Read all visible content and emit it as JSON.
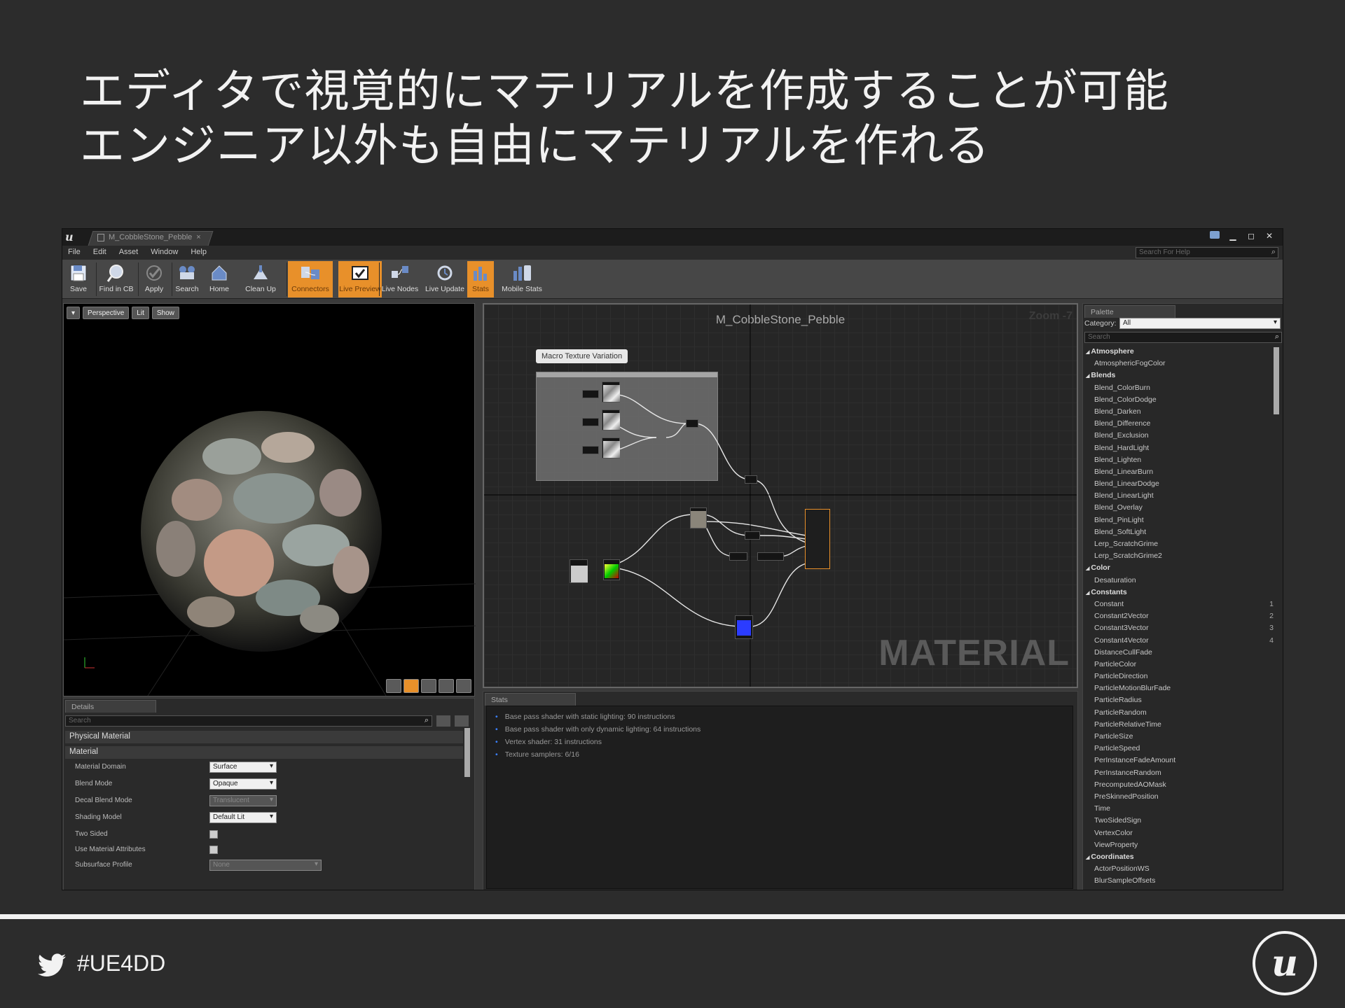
{
  "slide": {
    "title_line1": "エディタで視覚的にマテリアルを作成することが可能",
    "title_line2": "エンジニア以外も自由にマテリアルを作れる",
    "hashtag": "#UE4DD"
  },
  "window": {
    "tab_title": "M_CobbleStone_Pebble",
    "tab_close": "×"
  },
  "menu": [
    "File",
    "Edit",
    "Asset",
    "Window",
    "Help"
  ],
  "help_search": {
    "placeholder": "Search For Help"
  },
  "toolbar": [
    {
      "label": "Save",
      "icon": "save-icon",
      "active": false
    },
    {
      "label": "Find in CB",
      "icon": "find-in-content-browser-icon",
      "active": false
    },
    {
      "label": "Apply",
      "icon": "apply-icon",
      "active": false
    },
    {
      "label": "Search",
      "icon": "search-icon",
      "active": false
    },
    {
      "label": "Home",
      "icon": "home-icon",
      "active": false
    },
    {
      "label": "Clean Up",
      "icon": "clean-up-icon",
      "active": false
    },
    {
      "label": "Connectors",
      "icon": "connectors-icon",
      "active": true
    },
    {
      "label": "Live Preview",
      "icon": "live-preview-icon",
      "active": true
    },
    {
      "label": "Live Nodes",
      "icon": "live-nodes-icon",
      "active": false
    },
    {
      "label": "Live Update",
      "icon": "live-update-icon",
      "active": false
    },
    {
      "label": "Stats",
      "icon": "stats-icon",
      "active": true
    },
    {
      "label": "Mobile Stats",
      "icon": "mobile-stats-icon",
      "active": false
    }
  ],
  "viewport": {
    "perspective": "Perspective",
    "lit": "Lit",
    "show": "Show"
  },
  "details": {
    "tab": "Details",
    "search_placeholder": "Search",
    "cat_physical": "Physical Material",
    "cat_material": "Material",
    "props": [
      {
        "label": "Material Domain",
        "value": "Surface",
        "type": "dropdown"
      },
      {
        "label": "Blend Mode",
        "value": "Opaque",
        "type": "dropdown"
      },
      {
        "label": "Decal Blend Mode",
        "value": "Translucent",
        "type": "dropdown-disabled"
      },
      {
        "label": "Shading Model",
        "value": "Default Lit",
        "type": "dropdown"
      },
      {
        "label": "Two Sided",
        "value": "",
        "type": "checkbox"
      },
      {
        "label": "Use Material Attributes",
        "value": "",
        "type": "checkbox"
      },
      {
        "label": "Subsurface Profile",
        "value": "None",
        "type": "asset"
      }
    ]
  },
  "graph": {
    "title": "M_CobbleStone_Pebble",
    "zoom": "Zoom -7",
    "comment": "Macro Texture Variation",
    "watermark": "MATERIAL"
  },
  "stats": {
    "tab": "Stats",
    "lines": [
      "Base pass shader with static lighting: 90 instructions",
      "Base pass shader with only dynamic lighting: 64 instructions",
      "Vertex shader: 31 instructions",
      "Texture samplers: 6/16"
    ]
  },
  "palette": {
    "tab": "Palette",
    "category_label": "Category:",
    "category_value": "All",
    "search_placeholder": "Search",
    "items": [
      {
        "text": "Atmosphere",
        "head": true,
        "key": ""
      },
      {
        "text": "AtmosphericFogColor",
        "head": false,
        "key": ""
      },
      {
        "text": "Blends",
        "head": true,
        "key": ""
      },
      {
        "text": "Blend_ColorBurn",
        "head": false,
        "key": ""
      },
      {
        "text": "Blend_ColorDodge",
        "head": false,
        "key": ""
      },
      {
        "text": "Blend_Darken",
        "head": false,
        "key": ""
      },
      {
        "text": "Blend_Difference",
        "head": false,
        "key": ""
      },
      {
        "text": "Blend_Exclusion",
        "head": false,
        "key": ""
      },
      {
        "text": "Blend_HardLight",
        "head": false,
        "key": ""
      },
      {
        "text": "Blend_Lighten",
        "head": false,
        "key": ""
      },
      {
        "text": "Blend_LinearBurn",
        "head": false,
        "key": ""
      },
      {
        "text": "Blend_LinearDodge",
        "head": false,
        "key": ""
      },
      {
        "text": "Blend_LinearLight",
        "head": false,
        "key": ""
      },
      {
        "text": "Blend_Overlay",
        "head": false,
        "key": ""
      },
      {
        "text": "Blend_PinLight",
        "head": false,
        "key": ""
      },
      {
        "text": "Blend_SoftLight",
        "head": false,
        "key": ""
      },
      {
        "text": "Lerp_ScratchGrime",
        "head": false,
        "key": ""
      },
      {
        "text": "Lerp_ScratchGrime2",
        "head": false,
        "key": ""
      },
      {
        "text": "Color",
        "head": true,
        "key": ""
      },
      {
        "text": "Desaturation",
        "head": false,
        "key": ""
      },
      {
        "text": "Constants",
        "head": true,
        "key": ""
      },
      {
        "text": "Constant",
        "head": false,
        "key": "1"
      },
      {
        "text": "Constant2Vector",
        "head": false,
        "key": "2"
      },
      {
        "text": "Constant3Vector",
        "head": false,
        "key": "3"
      },
      {
        "text": "Constant4Vector",
        "head": false,
        "key": "4"
      },
      {
        "text": "DistanceCullFade",
        "head": false,
        "key": ""
      },
      {
        "text": "ParticleColor",
        "head": false,
        "key": ""
      },
      {
        "text": "ParticleDirection",
        "head": false,
        "key": ""
      },
      {
        "text": "ParticleMotionBlurFade",
        "head": false,
        "key": ""
      },
      {
        "text": "ParticleRadius",
        "head": false,
        "key": ""
      },
      {
        "text": "ParticleRandom",
        "head": false,
        "key": ""
      },
      {
        "text": "ParticleRelativeTime",
        "head": false,
        "key": ""
      },
      {
        "text": "ParticleSize",
        "head": false,
        "key": ""
      },
      {
        "text": "ParticleSpeed",
        "head": false,
        "key": ""
      },
      {
        "text": "PerInstanceFadeAmount",
        "head": false,
        "key": ""
      },
      {
        "text": "PerInstanceRandom",
        "head": false,
        "key": ""
      },
      {
        "text": "PrecomputedAOMask",
        "head": false,
        "key": ""
      },
      {
        "text": "PreSkinnedPosition",
        "head": false,
        "key": ""
      },
      {
        "text": "Time",
        "head": false,
        "key": ""
      },
      {
        "text": "TwoSidedSign",
        "head": false,
        "key": ""
      },
      {
        "text": "VertexColor",
        "head": false,
        "key": ""
      },
      {
        "text": "ViewProperty",
        "head": false,
        "key": ""
      },
      {
        "text": "Coordinates",
        "head": true,
        "key": ""
      },
      {
        "text": "ActorPositionWS",
        "head": false,
        "key": ""
      },
      {
        "text": "BlurSampleOffsets",
        "head": false,
        "key": ""
      }
    ]
  },
  "colors": {
    "accent_orange": "#e8902a",
    "slide_bg": "#2c2c2c",
    "stats_bullet": "#3a80ff"
  }
}
